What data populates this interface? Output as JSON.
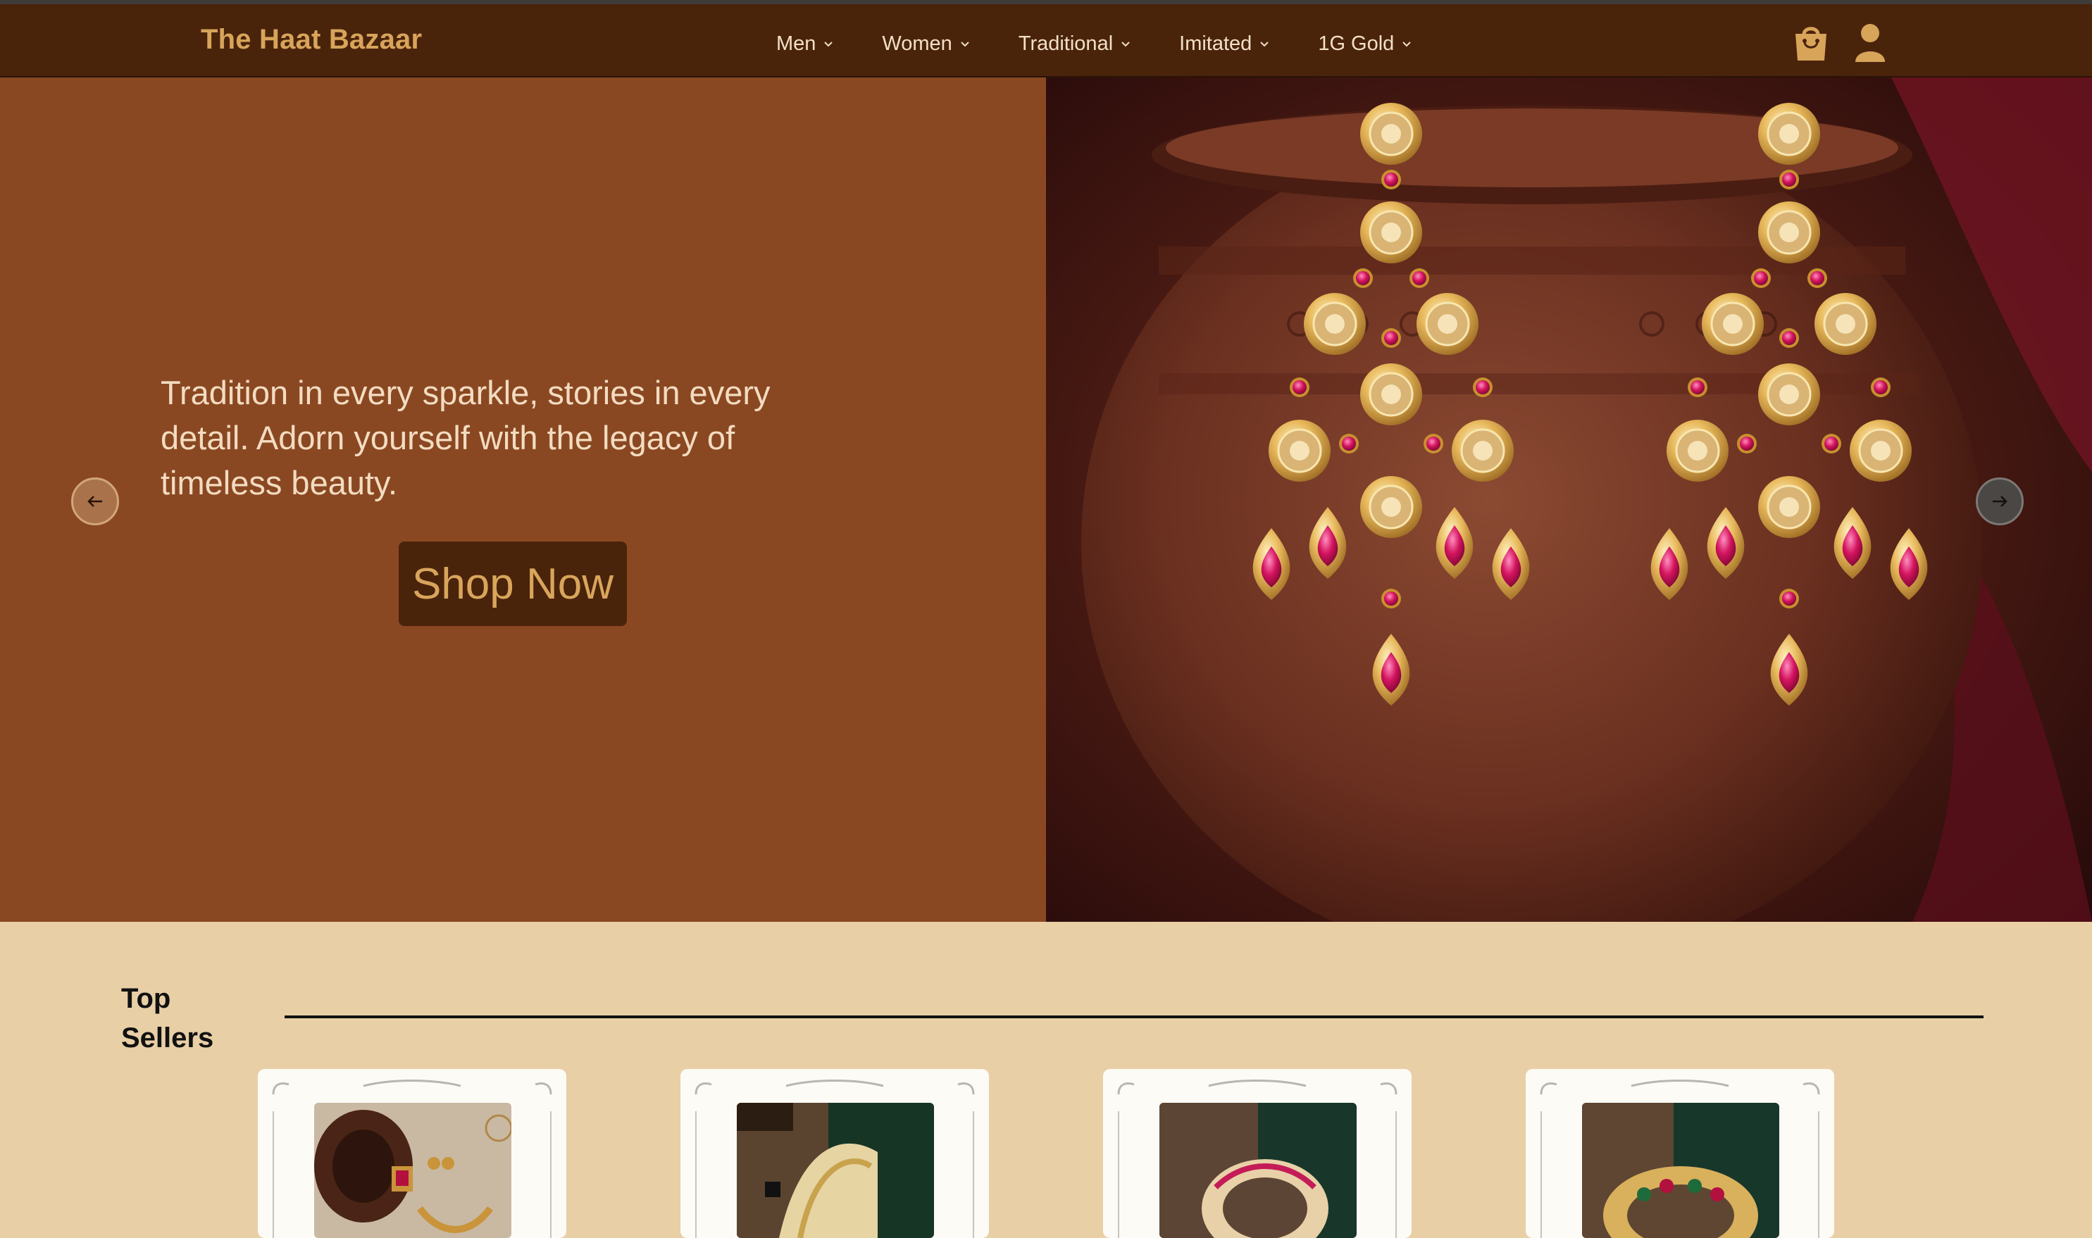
{
  "header": {
    "brand": "The Haat Bazaar",
    "nav": [
      {
        "label": "Men"
      },
      {
        "label": "Women"
      },
      {
        "label": "Traditional"
      },
      {
        "label": "Imitated"
      },
      {
        "label": "1G Gold"
      }
    ],
    "icons": {
      "cart": "shopping-bag-icon",
      "account": "user-icon"
    }
  },
  "hero": {
    "tagline": "Tradition in every sparkle, stories in every detail. Adorn yourself with the legacy of timeless beauty.",
    "cta_label": "Shop Now",
    "prev_icon": "arrow-left-icon",
    "next_icon": "arrow-right-icon"
  },
  "top_sellers": {
    "title": "Top Sellers",
    "products": [
      {
        "image": "necklace-set-image"
      },
      {
        "image": "bangles-image"
      },
      {
        "image": "bangles-image"
      },
      {
        "image": "kada-bangles-image"
      }
    ]
  },
  "colors": {
    "header_bg": "#4a230b",
    "brand_gold": "#d7a45a",
    "hero_bg": "#8a4822",
    "page_bg": "#e9cfa6"
  }
}
